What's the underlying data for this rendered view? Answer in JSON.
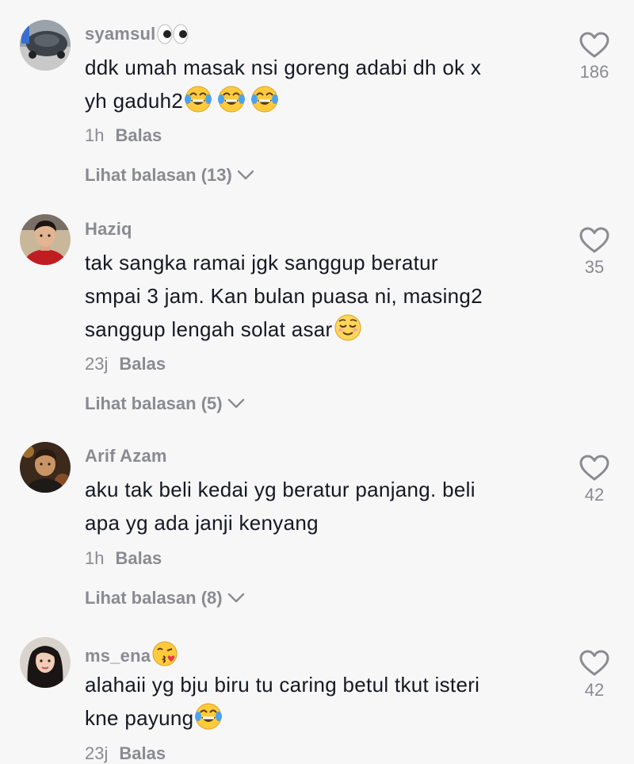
{
  "comments": [
    {
      "username": "syamsul",
      "text_lines": [
        "ddk umah masak nsi goreng adabi dh ok x",
        "yh gaduh2"
      ],
      "time": "1h",
      "reply_label": "Balas",
      "view_replies": "Lihat balasan (13)",
      "likes": "186",
      "avatar_icon": "avatar-car-icon",
      "username_emoji": "eyes-emoji-icon",
      "text_emoji": "tears-of-joy-emoji-icon"
    },
    {
      "username": "Haziq",
      "text_lines": [
        "tak sangka ramai jgk sanggup beratur",
        "smpai 3 jam. Kan bulan puasa ni, masing2",
        "sanggup lengah solat asar"
      ],
      "time": "23j",
      "reply_label": "Balas",
      "view_replies": "Lihat balasan (5)",
      "likes": "35",
      "avatar_icon": "avatar-man-red-shirt-icon",
      "text_emoji": "relieved-face-emoji-icon"
    },
    {
      "username": "Arif Azam",
      "text_lines": [
        "aku tak beli kedai yg beratur panjang. beli",
        "apa yg ada janji kenyang"
      ],
      "time": "1h",
      "reply_label": "Balas",
      "view_replies": "Lihat balasan (8)",
      "likes": "42",
      "avatar_icon": "avatar-man-icon"
    },
    {
      "username": "ms_ena",
      "text_lines": [
        "alahaii yg bju biru tu caring betul tkut isteri",
        "kne payung"
      ],
      "time": "23j",
      "reply_label": "Balas",
      "likes": "42",
      "avatar_icon": "avatar-woman-icon",
      "username_emoji": "kissing-face-emoji-icon",
      "text_emoji": "tears-of-joy-emoji-icon"
    }
  ],
  "colors": {
    "background": "#f7f7f7",
    "text": "#161823",
    "secondary": "#8a8b91"
  }
}
